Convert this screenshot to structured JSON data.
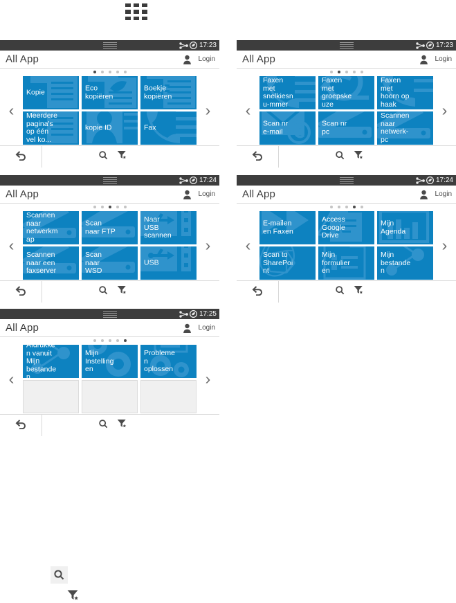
{
  "launcher": {
    "name": "all-apps-grid-icon",
    "cells": 9
  },
  "colors": {
    "tile_blue": "#0d82c0",
    "tile_art_blue": "#2f93cc",
    "statusbar": "#3d3d3d",
    "empty_tile": "#f0f0f0",
    "text_dark": "#3c3c3c"
  },
  "common": {
    "title": "All App",
    "login_label": "Login",
    "person_icon": "person-icon",
    "network_icon": "network-icon",
    "eco_icon": "eco-icon",
    "status_lines_icon": "status-handle-icon",
    "prev_arrow": "‹",
    "next_arrow": "›",
    "back_icon": "back-arrow-icon",
    "search_icon": "search-icon",
    "filter_icon": "filter-star-icon",
    "total_pages": 5
  },
  "panels": [
    {
      "id": "panel-copy",
      "time": "17:23",
      "active_page": 1,
      "tiles": [
        {
          "label": "Kopie",
          "art": "document-lines",
          "empty": false
        },
        {
          "label": "Eco kopiëren",
          "art": "document-leaf",
          "empty": false
        },
        {
          "label": "Boekje kopiëren",
          "art": "document-book",
          "empty": false
        },
        {
          "label": "Meerdere pagina's op één vel ko...",
          "art": "document-nup",
          "empty": false
        },
        {
          "label": "kopie ID",
          "art": "id-card",
          "empty": false
        },
        {
          "label": "Fax",
          "art": "fax-phone",
          "empty": false
        }
      ]
    },
    {
      "id": "panel-fax-scan",
      "time": "17:23",
      "active_page": 2,
      "tiles": [
        {
          "label": "Faxen met snelkiesnu-mmer",
          "art": "fax-phone",
          "empty": false
        },
        {
          "label": "Faxen met groepskeuze",
          "art": "fax-group",
          "empty": false
        },
        {
          "label": "Faxen met hoorn op haak",
          "art": "fax-handset",
          "empty": false
        },
        {
          "label": "Scan nr e-mail",
          "art": "envelope",
          "empty": false
        },
        {
          "label": "Scan nr pc",
          "art": "scanner-pc",
          "empty": false
        },
        {
          "label": "Scannen naar netwerk-pc",
          "art": "scanner-net",
          "empty": false
        }
      ]
    },
    {
      "id": "panel-scan-targets",
      "time": "17:24",
      "active_page": 3,
      "tiles": [
        {
          "label": "Scannen naar netwerkmap",
          "art": "scanner-net",
          "empty": false
        },
        {
          "label": "Scan naar FTP",
          "art": "scanner-pc",
          "empty": false
        },
        {
          "label": "Naar USB scannen",
          "art": "usb-drive",
          "empty": false
        },
        {
          "label": "Scannen naar een faxserver",
          "art": "scanner-net",
          "empty": false
        },
        {
          "label": "Scan naar WSD",
          "art": "scanner-pc",
          "empty": false
        },
        {
          "label": "USB",
          "art": "usb-drive",
          "empty": false
        }
      ]
    },
    {
      "id": "panel-cloud-apps",
      "time": "17:24",
      "active_page": 4,
      "tiles": [
        {
          "label": "E-mailen en Faxen",
          "art": "double-arrow",
          "empty": false
        },
        {
          "label": "Access Google Drive",
          "art": "drive-doc",
          "empty": false
        },
        {
          "label": "Mijn Agenda",
          "art": "calendar",
          "empty": false
        },
        {
          "label": "Scan to SharePoint",
          "art": "sharepoint",
          "empty": false
        },
        {
          "label": "Mijn formulieren",
          "art": "form-doc",
          "empty": false
        },
        {
          "label": "Mijn bestanden",
          "art": "files-share",
          "empty": false
        }
      ]
    },
    {
      "id": "panel-settings",
      "time": "17:25",
      "active_page": 5,
      "tiles": [
        {
          "label": "Afdrukken vanuit Mijn bestanden",
          "art": "files-share",
          "empty": false
        },
        {
          "label": "Mijn Instellingen",
          "art": "gears",
          "empty": false
        },
        {
          "label": "Problemen oplossen",
          "art": "gears-doc",
          "empty": false
        },
        {
          "label": "",
          "art": "",
          "empty": true
        },
        {
          "label": "",
          "art": "",
          "empty": true
        },
        {
          "label": "",
          "art": "",
          "empty": true
        }
      ]
    }
  ],
  "legend": {
    "search_icon": "search-icon",
    "filter_icon": "filter-star-icon"
  }
}
